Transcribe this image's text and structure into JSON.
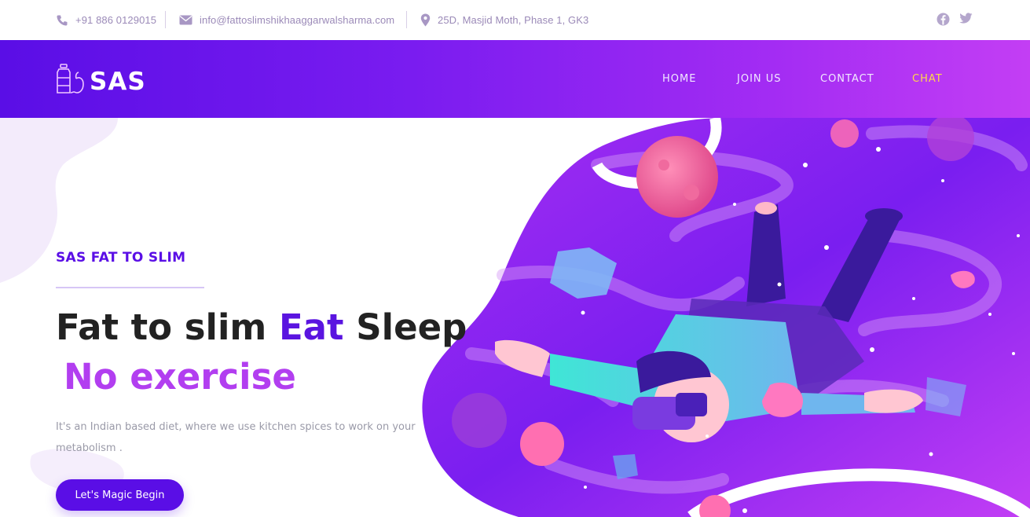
{
  "topbar": {
    "phone": "+91 886 0129015",
    "email": "info@fattoslimshikhaaggarwalsharma.com",
    "address": "25D, Masjid Moth, Phase 1, GK3",
    "phone_icon": "phone-icon",
    "email_icon": "envelope-icon",
    "address_icon": "map-pin-icon",
    "social": [
      "facebook-icon",
      "twitter-icon"
    ]
  },
  "nav": {
    "logo_text": "SAS",
    "logo_icon": "bottle-apple-icon",
    "items": [
      {
        "label": "HOME"
      },
      {
        "label": "JOIN US"
      },
      {
        "label": "CONTACT"
      },
      {
        "label": "CHAT"
      }
    ],
    "active_item": "CHAT"
  },
  "hero": {
    "eyebrow": "SAS FAT TO SLIM",
    "headline_part1": "Fat to slim ",
    "headline_accent": "Eat",
    "headline_part2": " Sleep",
    "headline_line2": "No exercise",
    "description": "It's an Indian based diet, where we use kitchen spices to work on your metabolism .",
    "cta_label": "Let's Magic Begin"
  },
  "colors": {
    "brand": "#5a0ee6",
    "accent_purple": "#b23ef0",
    "active_nav": "#ffd84a",
    "muted_text": "#9b8ab8"
  }
}
